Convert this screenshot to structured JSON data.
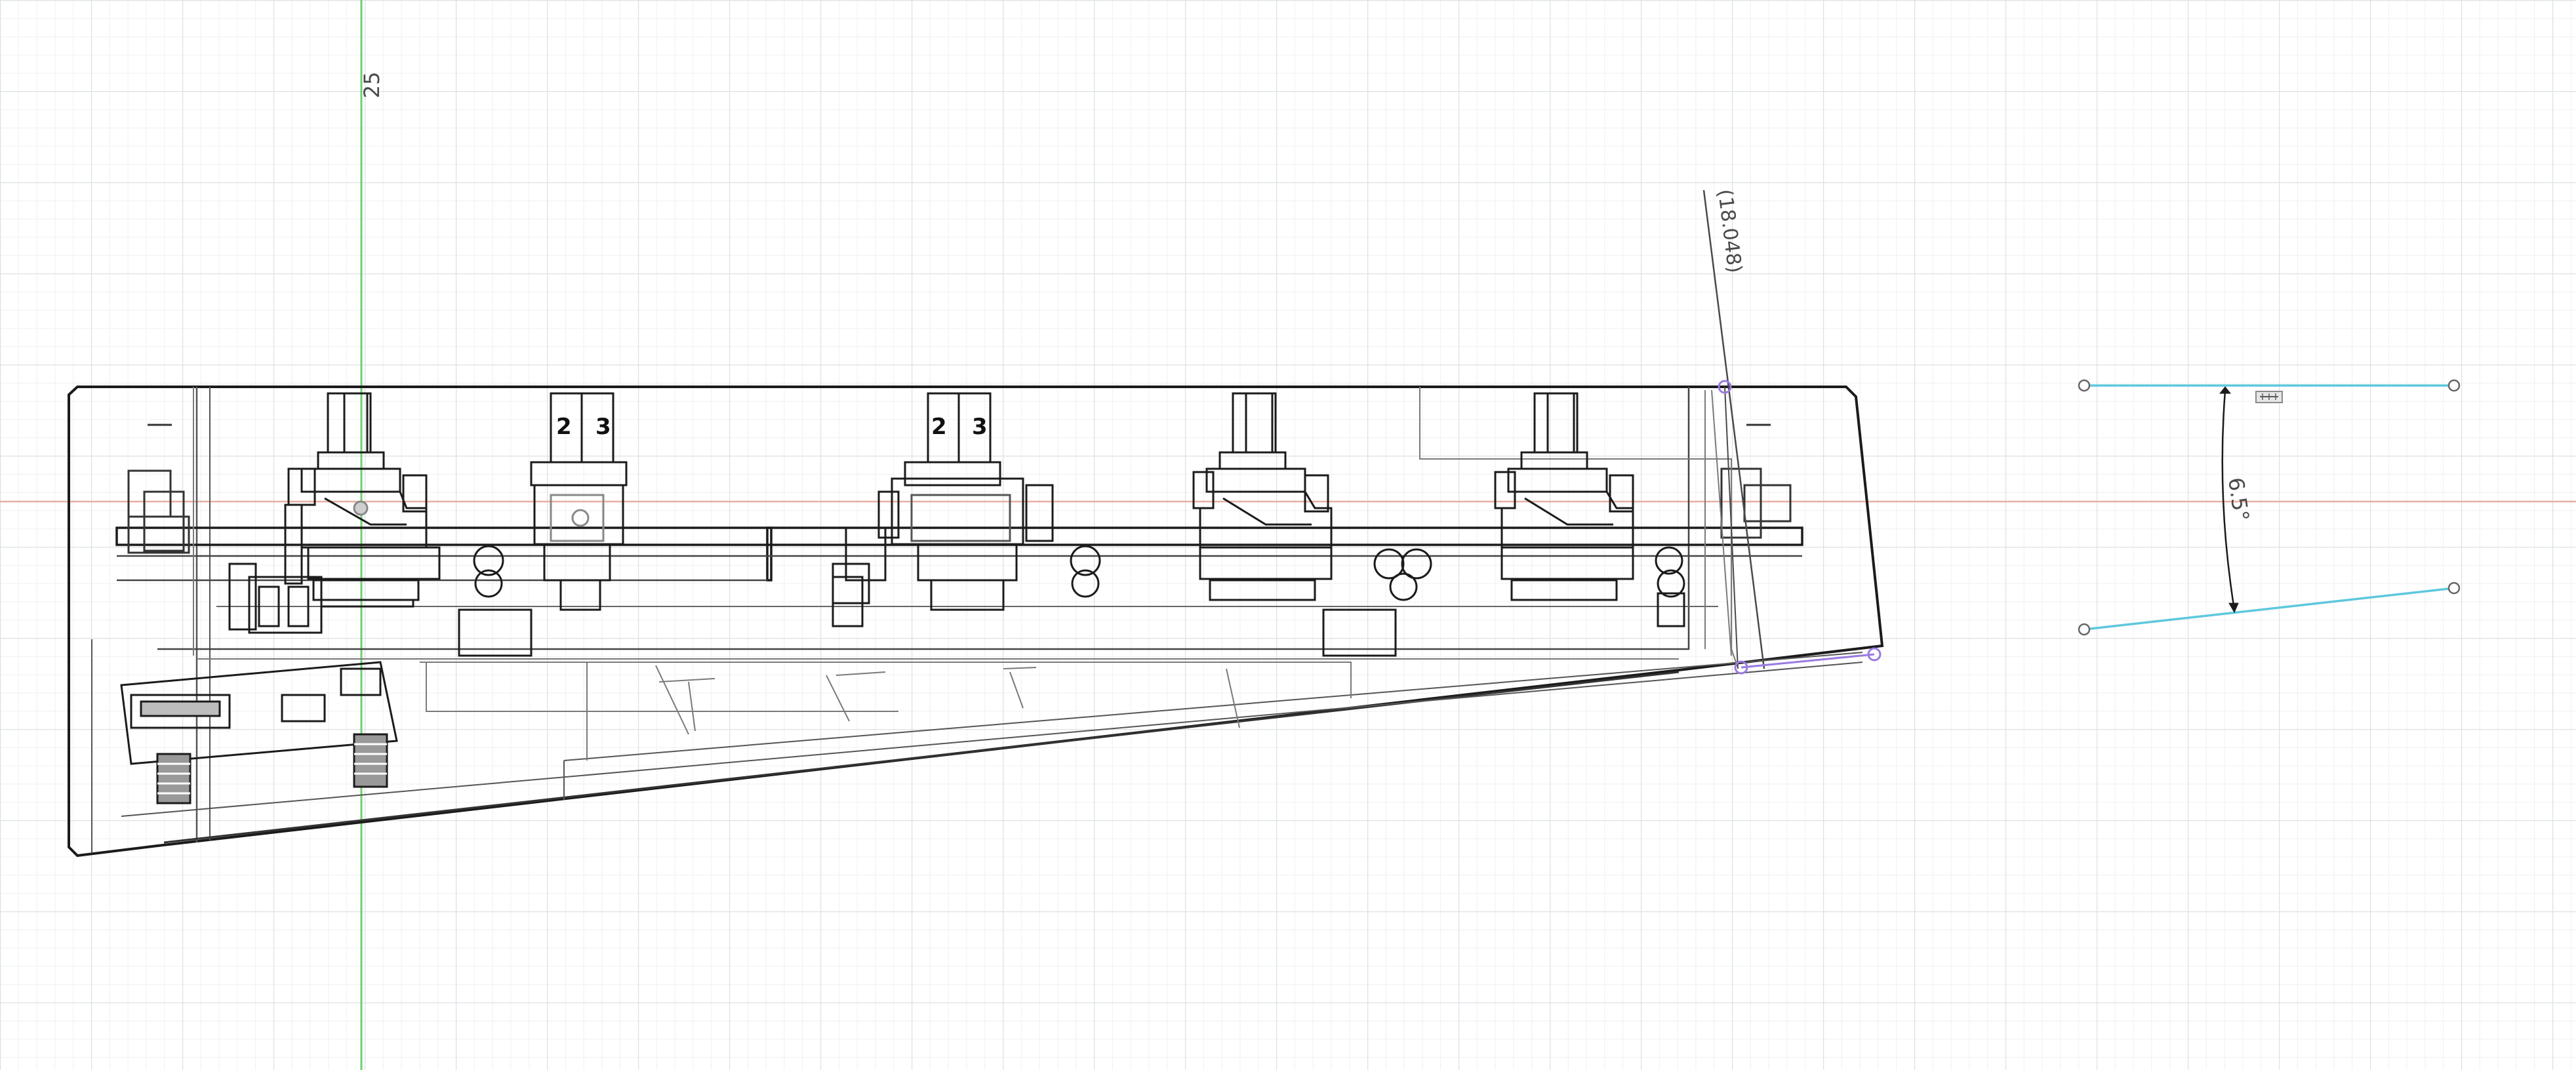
{
  "viewport": {
    "axis_label_vertical": "25",
    "colors": {
      "background": "#ffffff",
      "grid_minor": "#eef0f2",
      "grid_major": "#dde1e5",
      "y_axis": "#6fcf6f",
      "x_axis": "#e7b0a3",
      "model_lines": "#1b1b1b",
      "hidden_lines": "#6b6b6b",
      "sketch_blue": "#5ec8dd",
      "constraint_purple": "#9a7be0"
    }
  },
  "model": {
    "key_legends": [
      {
        "left": "2",
        "right": "3"
      },
      {
        "left": "2",
        "right": "3"
      }
    ]
  },
  "annotations": {
    "driven_dimension": "(18.048)",
    "angle_dimension": "6.5°",
    "constraint_icon": "horizontal-constraint-icon"
  }
}
